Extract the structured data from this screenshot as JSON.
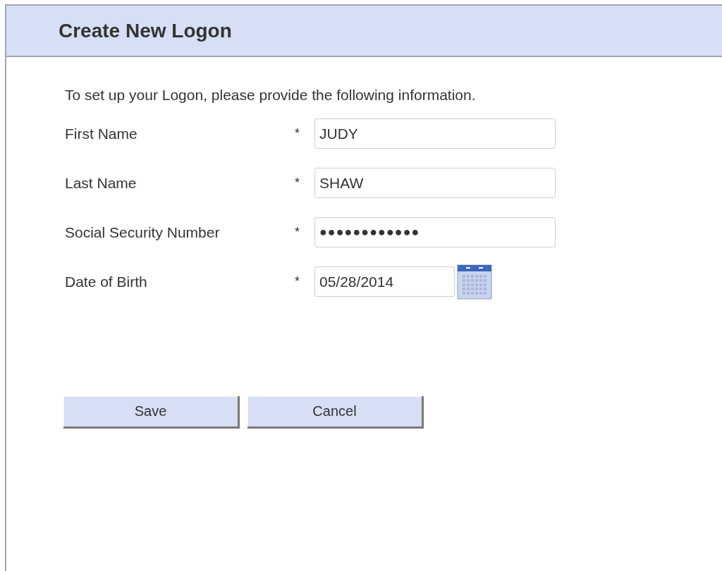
{
  "header": {
    "title": "Create New Logon"
  },
  "intro": "To set up your Logon, please provide the following information.",
  "fields": [
    {
      "kind": "text",
      "label": "First Name",
      "required_mark": "*",
      "value": "JUDY"
    },
    {
      "kind": "text",
      "label": "Last Name",
      "required_mark": "*",
      "value": "SHAW"
    },
    {
      "kind": "masked",
      "label": "Social Security Number",
      "required_mark": "*",
      "value": "●●●●●●●●●●●●"
    },
    {
      "kind": "date",
      "label": "Date of Birth",
      "required_mark": "*",
      "value": "05/28/2014"
    }
  ],
  "buttons": [
    "Save",
    "Cancel"
  ]
}
